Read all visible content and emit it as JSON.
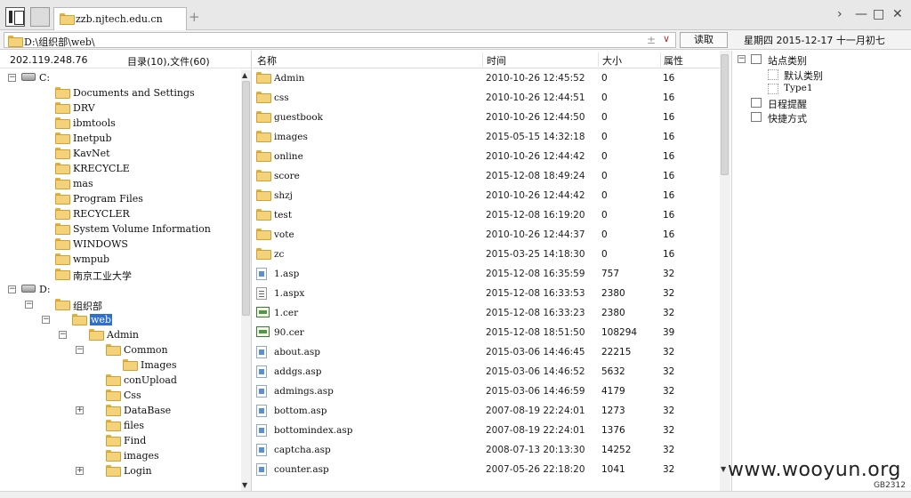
{
  "tab": {
    "label": "zzb.njtech.edu.cn",
    "add_label": "+"
  },
  "window_controls": {
    "forward": "›",
    "minimize": "—",
    "maximize": "□",
    "close": "✕"
  },
  "address": {
    "path": "D:\\组织部\\web\\",
    "plus": "±",
    "chevron": "∨",
    "read_button": "读取"
  },
  "date_info": "星期四 2015-12-17 十一月初七",
  "left_panel": {
    "ip": "202.119.248.76",
    "counts": "目录(10),文件(60)",
    "tree": [
      {
        "label": "C:",
        "icon": "drive-icon",
        "expander": "−",
        "indent": 0
      },
      {
        "label": "Documents and Settings",
        "icon": "folder-icon",
        "indent": 1
      },
      {
        "label": "DRV",
        "icon": "folder-icon",
        "indent": 1
      },
      {
        "label": "ibmtools",
        "icon": "folder-icon",
        "indent": 1
      },
      {
        "label": "Inetpub",
        "icon": "folder-icon",
        "indent": 1
      },
      {
        "label": "KavNet",
        "icon": "folder-icon",
        "indent": 1
      },
      {
        "label": "KRECYCLE",
        "icon": "folder-icon",
        "indent": 1
      },
      {
        "label": "mas",
        "icon": "folder-icon",
        "indent": 1
      },
      {
        "label": "Program Files",
        "icon": "folder-icon",
        "indent": 1
      },
      {
        "label": "RECYCLER",
        "icon": "folder-icon",
        "indent": 1
      },
      {
        "label": "System Volume Information",
        "icon": "folder-icon",
        "indent": 1
      },
      {
        "label": "WINDOWS",
        "icon": "folder-icon",
        "indent": 1
      },
      {
        "label": "wmpub",
        "icon": "folder-icon",
        "indent": 1
      },
      {
        "label": "南京工业大学",
        "icon": "folder-icon",
        "indent": 1
      },
      {
        "label": "D:",
        "icon": "drive-icon",
        "expander": "−",
        "indent": 0
      },
      {
        "label": "组织部",
        "icon": "folder-icon",
        "expander": "−",
        "indent": 1
      },
      {
        "label": "web",
        "icon": "folder-open-icon",
        "expander": "−",
        "indent": 2,
        "selected": true
      },
      {
        "label": "Admin",
        "icon": "folder-icon",
        "expander": "−",
        "indent": 3
      },
      {
        "label": "Common",
        "icon": "folder-icon",
        "expander": "−",
        "indent": 4
      },
      {
        "label": "Images",
        "icon": "folder-icon",
        "indent": 5
      },
      {
        "label": "conUpload",
        "icon": "folder-icon",
        "indent": 4
      },
      {
        "label": "Css",
        "icon": "folder-icon",
        "indent": 4
      },
      {
        "label": "DataBase",
        "icon": "folder-icon",
        "expander": "+",
        "indent": 4
      },
      {
        "label": "files",
        "icon": "folder-icon",
        "indent": 4
      },
      {
        "label": "Find",
        "icon": "folder-icon",
        "indent": 4
      },
      {
        "label": "images",
        "icon": "folder-icon",
        "indent": 4
      },
      {
        "label": "Login",
        "icon": "folder-icon",
        "expander": "+",
        "indent": 4
      }
    ]
  },
  "file_list": {
    "columns": {
      "name": "名称",
      "time": "时间",
      "size": "大小",
      "attr": "属性"
    },
    "rows": [
      {
        "name": "Admin",
        "time": "2010-10-26 12:45:52",
        "size": "0",
        "attr": "16",
        "icon": "folder-icon"
      },
      {
        "name": "css",
        "time": "2010-10-26 12:44:51",
        "size": "0",
        "attr": "16",
        "icon": "folder-icon"
      },
      {
        "name": "guestbook",
        "time": "2010-10-26 12:44:50",
        "size": "0",
        "attr": "16",
        "icon": "folder-icon"
      },
      {
        "name": "images",
        "time": "2015-05-15 14:32:18",
        "size": "0",
        "attr": "16",
        "icon": "folder-icon"
      },
      {
        "name": "online",
        "time": "2010-10-26 12:44:42",
        "size": "0",
        "attr": "16",
        "icon": "folder-icon"
      },
      {
        "name": "score",
        "time": "2015-12-08 18:49:24",
        "size": "0",
        "attr": "16",
        "icon": "folder-icon"
      },
      {
        "name": "shzj",
        "time": "2010-10-26 12:44:42",
        "size": "0",
        "attr": "16",
        "icon": "folder-icon"
      },
      {
        "name": "test",
        "time": "2015-12-08 16:19:20",
        "size": "0",
        "attr": "16",
        "icon": "folder-icon"
      },
      {
        "name": "vote",
        "time": "2010-10-26 12:44:37",
        "size": "0",
        "attr": "16",
        "icon": "folder-icon"
      },
      {
        "name": "zc",
        "time": "2015-03-25 14:18:30",
        "size": "0",
        "attr": "16",
        "icon": "folder-icon"
      },
      {
        "name": "1.asp",
        "time": "2015-12-08 16:35:59",
        "size": "757",
        "attr": "32",
        "icon": "file-icon"
      },
      {
        "name": "1.aspx",
        "time": "2015-12-08 16:33:53",
        "size": "2380",
        "attr": "32",
        "icon": "document-icon"
      },
      {
        "name": "1.cer",
        "time": "2015-12-08 16:33:23",
        "size": "2380",
        "attr": "32",
        "icon": "certificate-icon"
      },
      {
        "name": "90.cer",
        "time": "2015-12-08 18:51:50",
        "size": "108294",
        "attr": "39",
        "icon": "certificate-icon"
      },
      {
        "name": "about.asp",
        "time": "2015-03-06 14:46:45",
        "size": "22215",
        "attr": "32",
        "icon": "file-icon"
      },
      {
        "name": "addgs.asp",
        "time": "2015-03-06 14:46:52",
        "size": "5632",
        "attr": "32",
        "icon": "file-icon"
      },
      {
        "name": "admings.asp",
        "time": "2015-03-06 14:46:59",
        "size": "4179",
        "attr": "32",
        "icon": "file-icon"
      },
      {
        "name": "bottom.asp",
        "time": "2007-08-19 22:24:01",
        "size": "1273",
        "attr": "32",
        "icon": "file-icon"
      },
      {
        "name": "bottomindex.asp",
        "time": "2007-08-19 22:24:01",
        "size": "1376",
        "attr": "32",
        "icon": "file-icon"
      },
      {
        "name": "captcha.asp",
        "time": "2008-07-13 20:13:30",
        "size": "14252",
        "attr": "32",
        "icon": "file-icon"
      },
      {
        "name": "counter.asp",
        "time": "2007-05-26 22:18:20",
        "size": "1041",
        "attr": "32",
        "icon": "file-icon"
      }
    ]
  },
  "right_panel": {
    "items": [
      {
        "label": "站点类别",
        "expander": "−",
        "icon": "box-icon",
        "indent": 0
      },
      {
        "label": "默认类别",
        "icon": "dotted-box-icon",
        "indent": 1
      },
      {
        "label": "Type1",
        "icon": "dotted-box-icon",
        "indent": 1
      },
      {
        "label": "日程提醒",
        "icon": "calendar-icon",
        "indent": 0
      },
      {
        "label": "快捷方式",
        "icon": "shortcut-icon",
        "indent": 0
      }
    ]
  },
  "watermark": "www.wooyun.org",
  "encoding": "GB2312"
}
